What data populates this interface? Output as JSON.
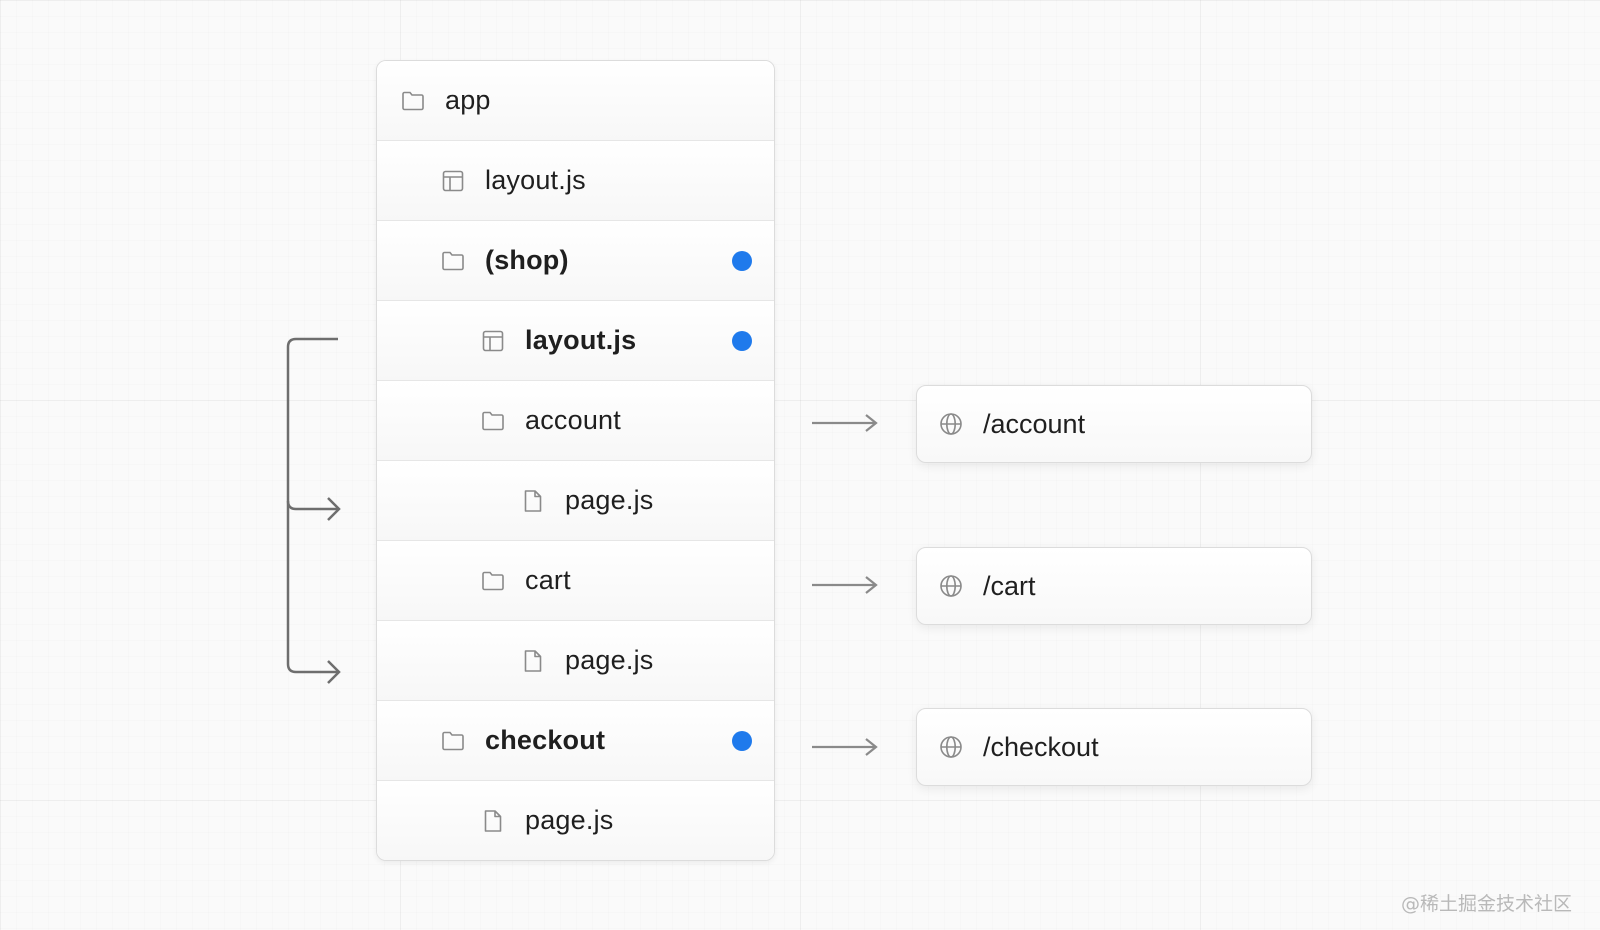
{
  "tree": {
    "rows": [
      {
        "label": "app",
        "icon": "folder-icon",
        "bold": false,
        "dot": false
      },
      {
        "label": "layout.js",
        "icon": "layout-icon",
        "bold": false,
        "dot": false
      },
      {
        "label": "(shop)",
        "icon": "folder-icon",
        "bold": true,
        "dot": true
      },
      {
        "label": "layout.js",
        "icon": "layout-icon",
        "bold": true,
        "dot": true
      },
      {
        "label": "account",
        "icon": "folder-icon",
        "bold": false,
        "dot": false
      },
      {
        "label": "page.js",
        "icon": "file-icon",
        "bold": false,
        "dot": false
      },
      {
        "label": "cart",
        "icon": "folder-icon",
        "bold": false,
        "dot": false
      },
      {
        "label": "page.js",
        "icon": "file-icon",
        "bold": false,
        "dot": false
      },
      {
        "label": "checkout",
        "icon": "folder-icon",
        "bold": true,
        "dot": true
      },
      {
        "label": "page.js",
        "icon": "file-icon",
        "bold": false,
        "dot": false
      }
    ]
  },
  "routes": [
    {
      "label": "/account",
      "icon": "globe-icon"
    },
    {
      "label": "/cart",
      "icon": "globe-icon"
    },
    {
      "label": "/checkout",
      "icon": "globe-icon"
    }
  ],
  "colors": {
    "dot": "#1f7aec",
    "arrow": "#8a8a8a",
    "bracket": "#6e6e6e"
  },
  "watermark": "@稀土掘金技术社区"
}
